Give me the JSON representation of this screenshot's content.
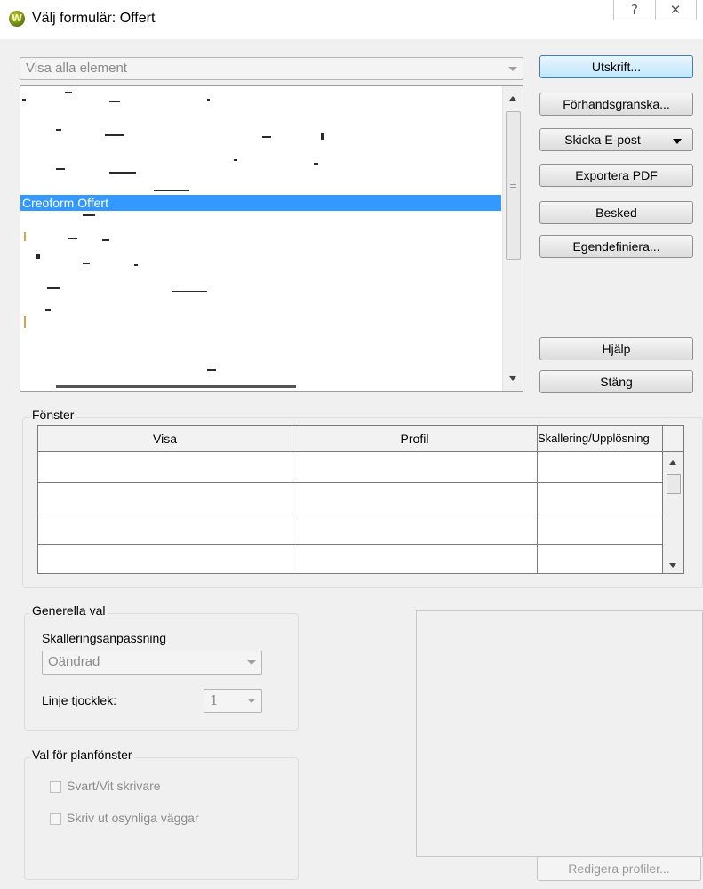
{
  "window": {
    "title": "Välj formulär: Offert",
    "app_icon_letter": "W",
    "help_glyph": "?",
    "close_glyph": "✕"
  },
  "filter": {
    "selected": "Visa alla element"
  },
  "list": {
    "selected_item": "Creoform Offert"
  },
  "buttons": {
    "print": "Utskrift...",
    "preview": "Förhandsgranska...",
    "email": "Skicka E-post",
    "export_pdf": "Exportera PDF",
    "message": "Besked",
    "customize": "Egendefiniera...",
    "help": "Hjälp",
    "close": "Stäng",
    "edit_profiles": "Redigera profiler..."
  },
  "windows_group": {
    "label": "Fönster",
    "columns": [
      "Visa",
      "Profil",
      "Skallering/Upplösning"
    ],
    "rows": [
      [
        "",
        "",
        ""
      ],
      [
        "",
        "",
        ""
      ],
      [
        "",
        "",
        ""
      ],
      [
        "",
        "",
        ""
      ]
    ]
  },
  "general": {
    "label": "Generella val",
    "scaling_label": "Skalleringsanpassning",
    "scaling_value": "Oändrad",
    "line_thickness_label": "Linje tjocklek:",
    "line_thickness_value": "1"
  },
  "plan": {
    "label": "Val för planfönster",
    "bw_printer": "Svart/Vit skrivare",
    "print_invisible_walls": "Skriv ut osynliga väggar"
  }
}
